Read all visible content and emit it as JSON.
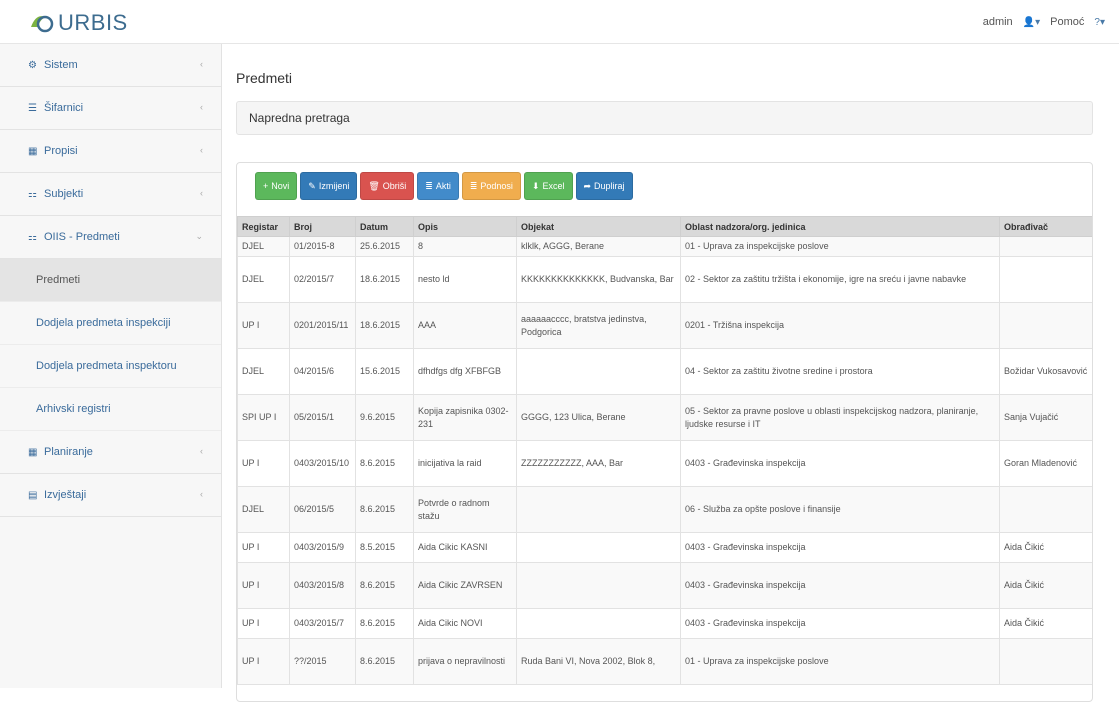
{
  "app": {
    "brand": "URBIS",
    "user": "admin",
    "help": "Pomoć"
  },
  "colors": {
    "primary": "#337ab7",
    "success": "#5cb85c",
    "danger": "#d9534f",
    "warning": "#f0ad4e",
    "info": "#428bca"
  },
  "sidebar": {
    "items": [
      {
        "label": "Sistem",
        "icon": "gear-icon"
      },
      {
        "label": "Šifarnici",
        "icon": "list-icon"
      },
      {
        "label": "Propisi",
        "icon": "grid-icon"
      },
      {
        "label": "Subjekti",
        "icon": "sitemap-icon"
      },
      {
        "label": "OIIS - Predmeti",
        "icon": "sitemap-icon"
      }
    ],
    "subitems": [
      {
        "label": "Predmeti"
      },
      {
        "label": "Dodjela predmeta inspekciji"
      },
      {
        "label": "Dodjela predmeta inspektoru"
      },
      {
        "label": "Arhivski registri"
      }
    ],
    "items_after": [
      {
        "label": "Planiranje",
        "icon": "grid-icon"
      },
      {
        "label": "Izvještaji",
        "icon": "chart-icon"
      }
    ]
  },
  "main": {
    "title": "Predmeti",
    "advanced_search": "Napredna pretraga"
  },
  "toolbar": {
    "buttons": [
      {
        "label": "Novi",
        "icon": "+"
      },
      {
        "label": "Izmijeni",
        "icon": "✎"
      },
      {
        "label": "Obriši",
        "icon": "🗑"
      },
      {
        "label": "Akti",
        "icon": "≣"
      },
      {
        "label": "Podnosi",
        "icon": "≣"
      },
      {
        "label": "Excel",
        "icon": "⬇"
      },
      {
        "label": "Dupliraj",
        "icon": "➦"
      }
    ]
  },
  "table": {
    "columns": [
      "Registar",
      "Broj",
      "Datum",
      "Opis",
      "Objekat",
      "Oblast nadzora/org. jedinica",
      "Obrađivač"
    ],
    "rows": [
      [
        "DJEL",
        "01/2015-8",
        "25.6.2015",
        "8",
        "klklk, AGGG, Berane",
        "01 - Uprava za inspekcijske poslove",
        ""
      ],
      [
        "DJEL",
        "02/2015/7",
        "18.6.2015",
        "nesto ld",
        "KKKKKKKKKKKKKK, Budvanska, Bar",
        "02 - Sektor za zaštitu tržišta i ekonomije, igre na sreću i javne nabavke",
        ""
      ],
      [
        "UP I",
        "0201/2015/11",
        "18.6.2015",
        "AAA",
        "aaaaaacccc, bratstva jedinstva, Podgorica",
        "0201 - Tržišna inspekcija",
        ""
      ],
      [
        "DJEL",
        "04/2015/6",
        "15.6.2015",
        "dfhdfgs dfg XFBFGB",
        "",
        "04 - Sektor za zaštitu životne sredine i prostora",
        "Božidar Vukosavović"
      ],
      [
        "SPI UP I",
        "05/2015/1",
        "9.6.2015",
        "Kopija zapisnika 0302-231",
        "GGGG, 123 Ulica, Berane",
        "05 - Sektor za pravne poslove u oblasti inspekcijskog nadzora, planiranje, ljudske resurse i IT",
        "Sanja Vujačić"
      ],
      [
        "UP I",
        "0403/2015/10",
        "8.6.2015",
        "inicijativa la raid",
        "ZZZZZZZZZZZ, AAA, Bar",
        "0403 - Građevinska inspekcija",
        "Goran Mladenović"
      ],
      [
        "DJEL",
        "06/2015/5",
        "8.6.2015",
        "Potvrde o radnom stažu",
        "",
        "06 - Služba za opšte poslove i finansije",
        ""
      ],
      [
        "UP I",
        "0403/2015/9",
        "8.5.2015",
        "Aida Cikic KASNI",
        "",
        "0403 - Građevinska inspekcija",
        "Aida Čikić"
      ],
      [
        "UP I",
        "0403/2015/8",
        "8.6.2015",
        "Aida Cikic ZAVRSEN",
        "",
        "0403 - Građevinska inspekcija",
        "Aida Čikić"
      ],
      [
        "UP I",
        "0403/2015/7",
        "8.6.2015",
        "Aida Cikic NOVI",
        "",
        "0403 - Građevinska inspekcija",
        "Aida Čikić"
      ],
      [
        "UP I",
        "??/2015",
        "8.6.2015",
        "prijava o nepravilnosti",
        "Ruda Bani VI, Nova 2002, Blok 8,",
        "01 - Uprava za inspekcijske poslove",
        ""
      ]
    ]
  }
}
